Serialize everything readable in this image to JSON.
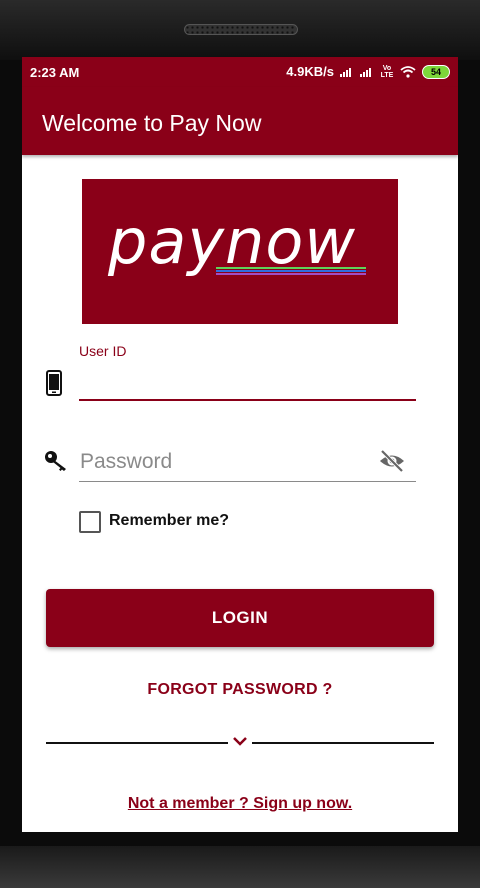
{
  "status_bar": {
    "time": "2:23 AM",
    "speed": "4.9KB/s",
    "network_badge": "Vo LTE",
    "battery": "54"
  },
  "app_bar": {
    "title": "Welcome to Pay Now"
  },
  "logo": {
    "text": "paynow",
    "stripe_colors": [
      "#5fd35a",
      "#2f6ee0",
      "#a24cc4"
    ]
  },
  "login_form": {
    "user_id_label": "User ID",
    "user_id_value": "",
    "password_placeholder": "Password",
    "remember_label": "Remember me?",
    "remember_checked": false,
    "login_button": "LOGIN"
  },
  "links": {
    "forgot_password": "FORGOT PASSWORD ?",
    "signup": "Not a member ? Sign up now."
  },
  "colors": {
    "primary": "#8a0018",
    "text_dark": "#111111",
    "hint": "#8a8a8a"
  }
}
